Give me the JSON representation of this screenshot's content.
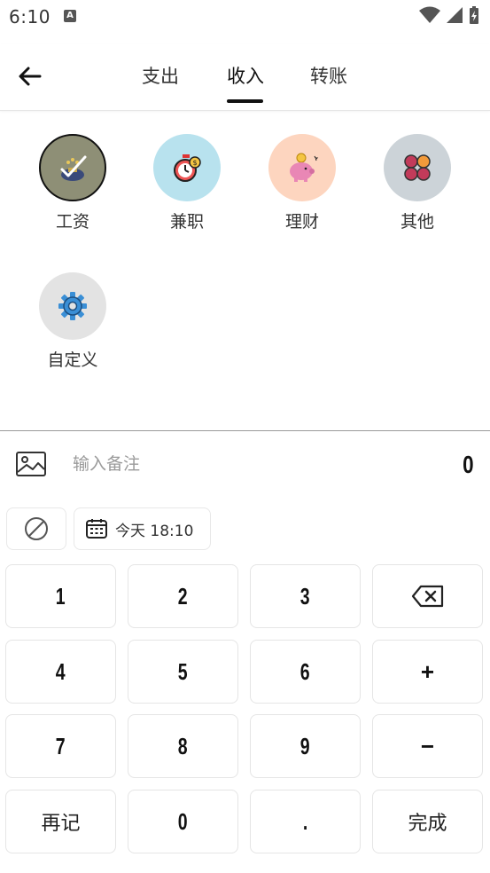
{
  "status_bar": {
    "time": "6:10",
    "notification_glyph": "A"
  },
  "header": {
    "back_icon": "arrow-left-icon",
    "tabs": [
      {
        "label": "支出",
        "active": false
      },
      {
        "label": "收入",
        "active": true
      },
      {
        "label": "转账",
        "active": false
      }
    ]
  },
  "categories": [
    {
      "label": "工资",
      "icon": "salary-money-bag-icon",
      "bg": "#8e8f76",
      "selected": true
    },
    {
      "label": "兼职",
      "icon": "stopwatch-coin-icon",
      "bg": "#b8e2ee",
      "selected": false
    },
    {
      "label": "理财",
      "icon": "piggy-bank-icon",
      "bg": "#fdd5bf",
      "selected": false
    },
    {
      "label": "其他",
      "icon": "four-petal-grid-icon",
      "bg": "#ccd3d8",
      "selected": false
    },
    {
      "label": "自定义",
      "icon": "gear-icon",
      "bg": "#e3e3e3",
      "selected": false
    }
  ],
  "note": {
    "placeholder": "输入备注",
    "amount": "0"
  },
  "date_chip": {
    "label": "今天 18:10"
  },
  "keypad": {
    "rows": [
      [
        "1",
        "2",
        "3",
        "backspace"
      ],
      [
        "4",
        "5",
        "6",
        "+"
      ],
      [
        "7",
        "8",
        "9",
        "−"
      ],
      [
        "再记",
        "0",
        ".",
        "完成"
      ]
    ]
  },
  "colors": {
    "accent": "#111111",
    "salary_bg": "#8e8f76",
    "parttime_bg": "#b8e2ee",
    "finance_bg": "#fdd5bf",
    "other_bg": "#ccd3d8",
    "custom_bg": "#e3e3e3"
  }
}
